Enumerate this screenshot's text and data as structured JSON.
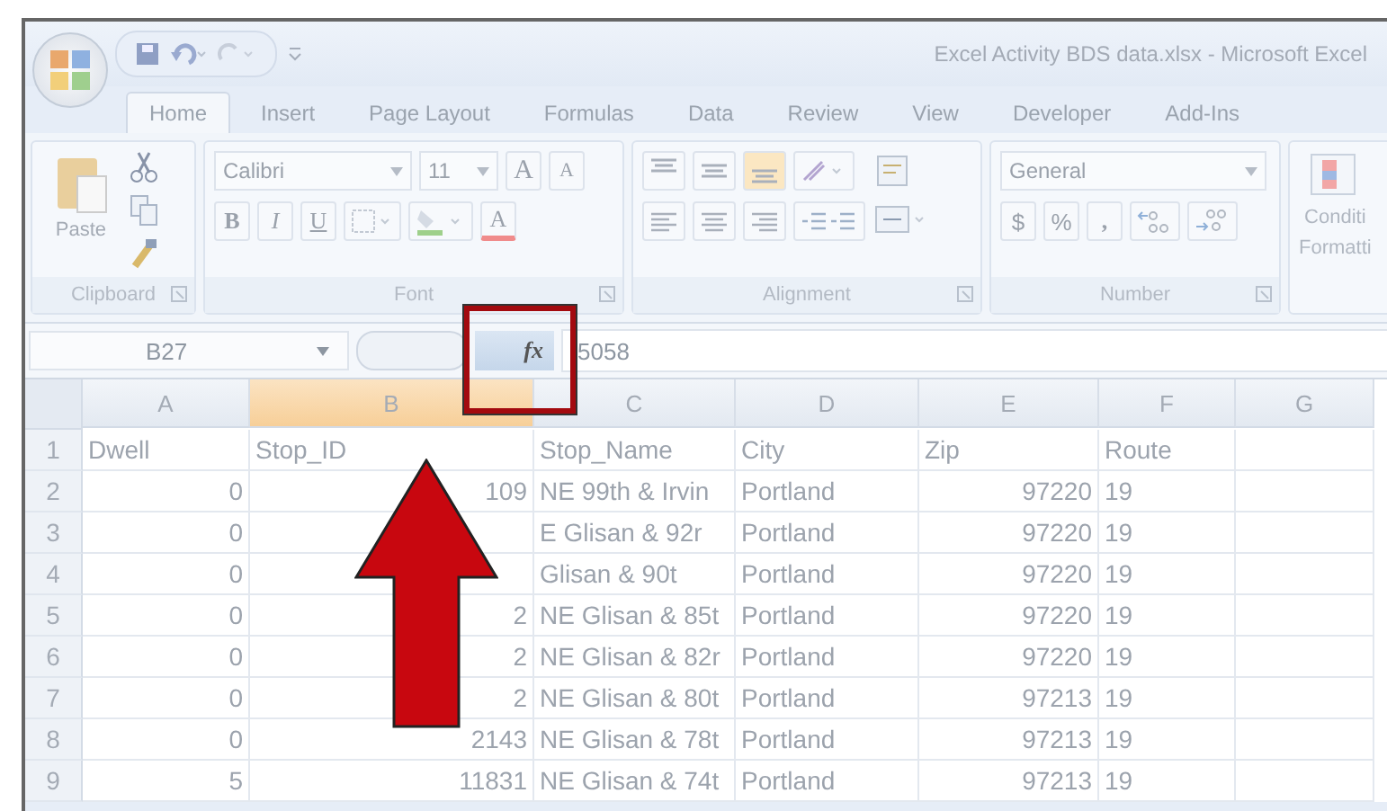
{
  "window": {
    "title": "Excel Activity BDS data.xlsx - Microsoft Excel"
  },
  "ribbon_tabs": [
    {
      "label": "Home",
      "selected": true
    },
    {
      "label": "Insert",
      "selected": false
    },
    {
      "label": "Page Layout",
      "selected": false
    },
    {
      "label": "Formulas",
      "selected": false
    },
    {
      "label": "Data",
      "selected": false
    },
    {
      "label": "Review",
      "selected": false
    },
    {
      "label": "View",
      "selected": false
    },
    {
      "label": "Developer",
      "selected": false
    },
    {
      "label": "Add-Ins",
      "selected": false
    }
  ],
  "clipboard": {
    "paste": "Paste",
    "label": "Clipboard"
  },
  "font": {
    "name": "Calibri",
    "size": "11",
    "grow": "A",
    "shrink": "A",
    "bold": "B",
    "italic": "I",
    "underline": "U",
    "font_color": "A",
    "label": "Font"
  },
  "alignment": {
    "label": "Alignment"
  },
  "number": {
    "format": "General",
    "currency": "$",
    "percent": "%",
    "comma": ",",
    "label": "Number"
  },
  "styles": {
    "conditional_formatting": [
      "Conditi",
      "Formatti"
    ]
  },
  "formula_bar": {
    "name_box": "B27",
    "fx": "fx",
    "value": "5058"
  },
  "columns": [
    {
      "label": "A",
      "selected": false,
      "kind": "number"
    },
    {
      "label": "B",
      "selected": true,
      "kind": "number"
    },
    {
      "label": "C",
      "selected": false,
      "kind": "text"
    },
    {
      "label": "D",
      "selected": false,
      "kind": "text"
    },
    {
      "label": "E",
      "selected": false,
      "kind": "number"
    },
    {
      "label": "F",
      "selected": false,
      "kind": "text"
    },
    {
      "label": "G",
      "selected": false,
      "kind": "text"
    }
  ],
  "rows": [
    {
      "number": "1",
      "cells": [
        "Dwell",
        "Stop_ID",
        "Stop_Name",
        "City",
        "Zip",
        "Route"
      ]
    },
    {
      "number": "2",
      "cells": [
        "0",
        "109",
        "NE 99th & Irvin",
        "Portland",
        "97220",
        "19"
      ]
    },
    {
      "number": "3",
      "cells": [
        "0",
        null,
        "E Glisan & 92r",
        "Portland",
        "97220",
        "19"
      ]
    },
    {
      "number": "4",
      "cells": [
        "0",
        null,
        "Glisan & 90t",
        "Portland",
        "97220",
        "19"
      ]
    },
    {
      "number": "5",
      "cells": [
        "0",
        "2",
        "NE Glisan & 85t",
        "Portland",
        "97220",
        "19"
      ]
    },
    {
      "number": "6",
      "cells": [
        "0",
        "2",
        "NE Glisan & 82r",
        "Portland",
        "97220",
        "19"
      ]
    },
    {
      "number": "7",
      "cells": [
        "0",
        "2",
        "NE Glisan & 80t",
        "Portland",
        "97213",
        "19"
      ]
    },
    {
      "number": "8",
      "cells": [
        "0",
        "2143",
        "NE Glisan & 78t",
        "Portland",
        "97213",
        "19"
      ]
    },
    {
      "number": "9",
      "cells": [
        "5",
        "11831",
        "NE Glisan & 74t",
        "Portland",
        "97213",
        "19"
      ]
    }
  ]
}
